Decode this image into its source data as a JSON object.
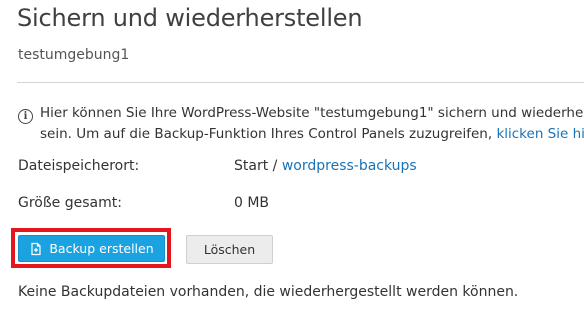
{
  "page": {
    "title": "Sichern und wiederherstellen",
    "subtitle": "testumgebung1"
  },
  "info": {
    "icon": "info-icon",
    "line1": "Hier können Sie Ihre WordPress-Website \"testumgebung1\" sichern und wiederherstellen",
    "line2": "sein. Um auf die Backup-Funktion Ihres Control Panels zuzugreifen, ",
    "link_label": "klicken Sie hier",
    "link_suffix": "."
  },
  "details": {
    "location_label": "Dateispeicherort:",
    "location_prefix": "Start / ",
    "location_link": "wordpress-backups",
    "size_label": "Größe gesamt:",
    "size_value": "0 MB"
  },
  "actions": {
    "create_backup_label": "Backup erstellen",
    "create_backup_icon": "backup-icon",
    "delete_label": "Löschen",
    "highlight_color": "#e3161e",
    "primary_color": "#1aa3e0"
  },
  "status": {
    "empty_message": "Keine Backupdateien vorhanden, die wiederhergestellt werden können."
  }
}
